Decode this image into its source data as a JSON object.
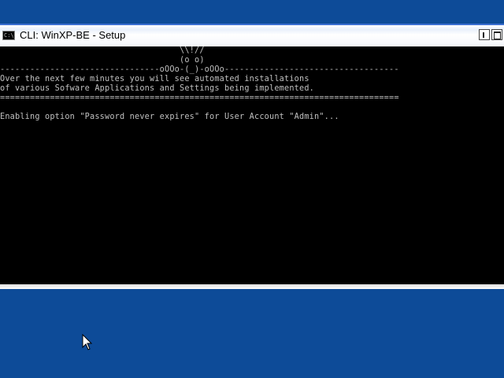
{
  "window": {
    "title": "CLI: WinXP-BE - Setup",
    "icon_text": "C:\\",
    "icon_name": "console-icon",
    "buttons": [
      "minimize",
      "maximize"
    ]
  },
  "console": {
    "lines": [
      "                                    \\\\!//",
      "                                    (o o)",
      "--------------------------------oOOo-(_)-oOOo-----------------------------------",
      "Over the next few minutes you will see automated installations",
      "of various Sofware Applications and Settings being implemented.",
      "================================================================================",
      "",
      "Enabling option \"Password never expires\" for User Account \"Admin\"..."
    ]
  },
  "colors": {
    "desktop": "#0d4b98",
    "console_bg": "#000000",
    "console_text": "#c0c0c0"
  }
}
